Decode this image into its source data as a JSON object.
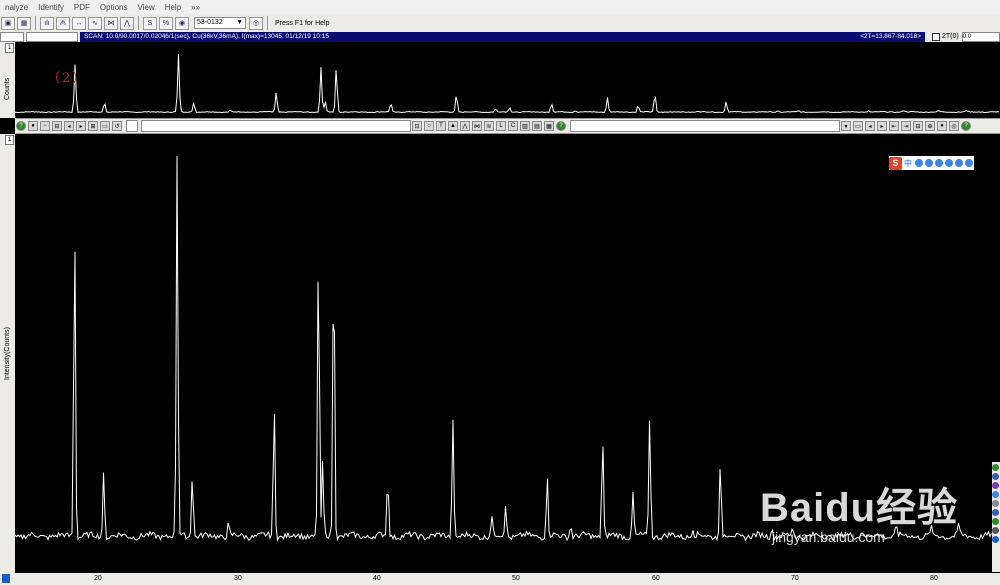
{
  "menu": [
    "nalyze",
    "Identify",
    "PDF",
    "Options",
    "View",
    "Help",
    "»»"
  ],
  "toolbar1": {
    "pdf_combo": "53-0132",
    "status": "Press F1 for Help"
  },
  "scanbar": {
    "info": "SCAN: 10.0/90.0017/0.02046/1(sec), Cu(36kV,36mA), I(max)=13045, 01/12/19 10:15",
    "cursor": "<2T=13.867-84.018>",
    "twotheta_label": "2T(0)",
    "twotheta_value": "0.0"
  },
  "top_panel": {
    "tag": "1",
    "ylabel": "Counts",
    "annotation": "（2）"
  },
  "main_panel": {
    "tag": "1",
    "ylabel": "Intensity(Counts)"
  },
  "xaxis_ticks": [
    "20",
    "30",
    "40",
    "50",
    "60",
    "70",
    "80"
  ],
  "watermark": {
    "brand": "Baidu经验",
    "url": "jingyan.baidu.com"
  },
  "ime": {
    "label": "中"
  },
  "colors": {
    "trace": "#ffffff",
    "background": "#000000",
    "toolbar": "#ecebe8",
    "scanbar": "#0a0a70",
    "annotation": "#d21c1c"
  }
}
